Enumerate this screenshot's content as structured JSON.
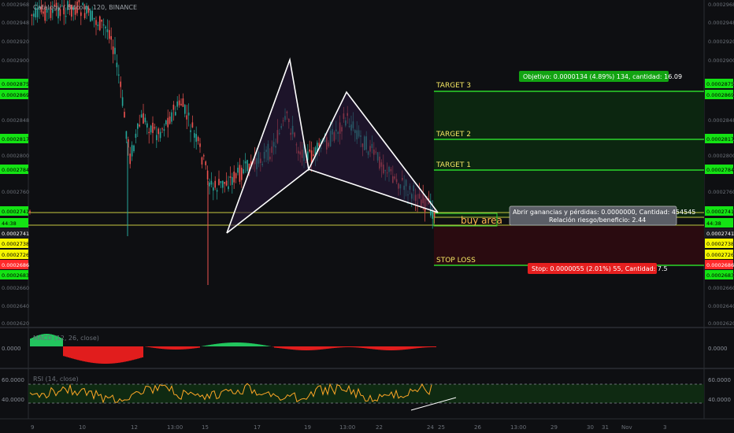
{
  "symbol_title": "Catalogy / Bitcoin, 120, BINANCE",
  "colors": {
    "background": "#0e0f12",
    "up_candle": "#26a69a",
    "down_candle": "#ef5350",
    "target_line": "#2bd62b",
    "stop_line": "#2bd62b",
    "profit_zone": "#0c2610",
    "loss_zone": "#2a0b10",
    "pattern_line": "#ffffff",
    "pattern_fill": "#2a1a3e",
    "buy_area_text": "#ffb74d",
    "rsi_line": "#ffa726",
    "macd_pos": "#22c55e",
    "macd_neg": "#e11d1d",
    "price_tag_green": "#14e314",
    "price_tag_yellow": "#f5f500",
    "price_tag_red": "#ff2a2a"
  },
  "axis": {
    "price_ticks": [
      "0.0002968",
      "0.0002948",
      "0.0002920",
      "0.0002900",
      "0.0002875",
      "0.0002869",
      "0.0002848",
      "0.0002817",
      "0.0002800",
      "0.0002784",
      "0.0002760",
      "0.0002741",
      "0.0002741",
      "0.0002738",
      "0.0002726",
      "0.0002686",
      "0.0002683",
      "0.0002660",
      "0.0002640",
      "0.0002620"
    ],
    "x_ticks": [
      "9",
      "10",
      "12",
      "13:00",
      "15",
      "17",
      "19",
      "13:00",
      "22",
      "24",
      "25",
      "26",
      "13:00",
      "29",
      "30",
      "31",
      "Nov",
      "3"
    ]
  },
  "levels": {
    "target3": "TARGET 3",
    "target2": "TARGET 2",
    "target1": "TARGET 1",
    "stop_loss": "STOP LOSS",
    "buy_area": "buy area"
  },
  "labels": {
    "objective": "Objetivo: 0.0000134 (4.89%) 134, cantidad: 16.09",
    "open_pnl_line1": "Abrir ganancias y pérdidas: 0.0000000, Cantidad: 454545",
    "open_pnl_line2": "Relación riesgo/beneficio: 2.44",
    "stop": "Stop: 0.0000055 (2.01%) 55, Cantidad: 7.5",
    "countdown": "44:38"
  },
  "price_tags_right": [
    {
      "text": "0.0002875",
      "style": "green"
    },
    {
      "text": "0.0002869",
      "style": "green"
    },
    {
      "text": "0.0002817",
      "style": "green"
    },
    {
      "text": "0.0002784",
      "style": "green"
    },
    {
      "text": "0.0002741",
      "style": "green"
    },
    {
      "text": "44:38",
      "style": "green"
    },
    {
      "text": "0.0002741",
      "style": "dark"
    },
    {
      "text": "0.0002738",
      "style": "yellow"
    },
    {
      "text": "0.0002726",
      "style": "yellow"
    },
    {
      "text": "0.0002686",
      "style": "red"
    },
    {
      "text": "0.0002683",
      "style": "green"
    }
  ],
  "price_tags_left": [
    {
      "text": "0.0002875",
      "style": "green"
    },
    {
      "text": "0.0002869",
      "style": "green"
    },
    {
      "text": "0.0002817",
      "style": "green"
    },
    {
      "text": "0.0002784",
      "style": "green"
    },
    {
      "text": "0.0002741",
      "style": "green"
    },
    {
      "text": "44:38",
      "style": "green"
    },
    {
      "text": "0.0002741",
      "style": "dark"
    },
    {
      "text": "0.0002738",
      "style": "yellow"
    },
    {
      "text": "0.0002726",
      "style": "yellow"
    },
    {
      "text": "0.0002686",
      "style": "red"
    },
    {
      "text": "0.0002683",
      "style": "green"
    }
  ],
  "macd_panel": {
    "label": "MACD (12, 26, close)",
    "right_tick": "0.0000",
    "left_tick": "0.0000"
  },
  "rsi_panel": {
    "label": "RSI (14, close)",
    "upper": "60.0000",
    "lower": "40.0000"
  },
  "chart_data": {
    "type": "candlestick",
    "title": "Catalogy / Bitcoin, 120, BINANCE",
    "interval": "120",
    "exchange": "BINANCE",
    "x_ticks": [
      "9",
      "10",
      "12",
      "13:00",
      "15",
      "17",
      "19",
      "13:00",
      "22",
      "24",
      "25",
      "26",
      "13:00",
      "29",
      "30",
      "31",
      "Nov",
      "3"
    ],
    "price_range_visible": [
      0.000262,
      0.000297
    ],
    "harmonic_pattern": {
      "points_price": [
        0.000273,
        0.00029,
        0.000278,
        0.000286,
        0.000274
      ]
    },
    "levels": {
      "target3": 0.0002875,
      "target2": 0.0002817,
      "target1": 0.0002784,
      "entry": 0.0002741,
      "stop_loss": 0.0002686
    },
    "rsi_band": [
      40,
      60
    ]
  }
}
